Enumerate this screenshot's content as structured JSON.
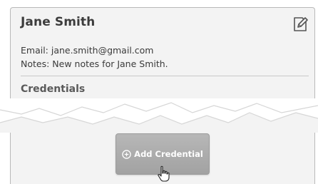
{
  "contact": {
    "name": "Jane Smith",
    "email_line": "Email: jane.smith@gmail.com",
    "notes_line": "Notes: New notes for Jane Smith."
  },
  "credentials": {
    "section_title": "Credentials",
    "add_button_label": "Add Credential"
  },
  "icons": {
    "edit": "edit-note-icon",
    "add": "plus-circle-icon",
    "cursor": "hand-pointer-icon"
  },
  "colors": {
    "card_background": "#f3f3f3",
    "button_background": "#a9a9a9",
    "button_text": "#ffffff"
  }
}
